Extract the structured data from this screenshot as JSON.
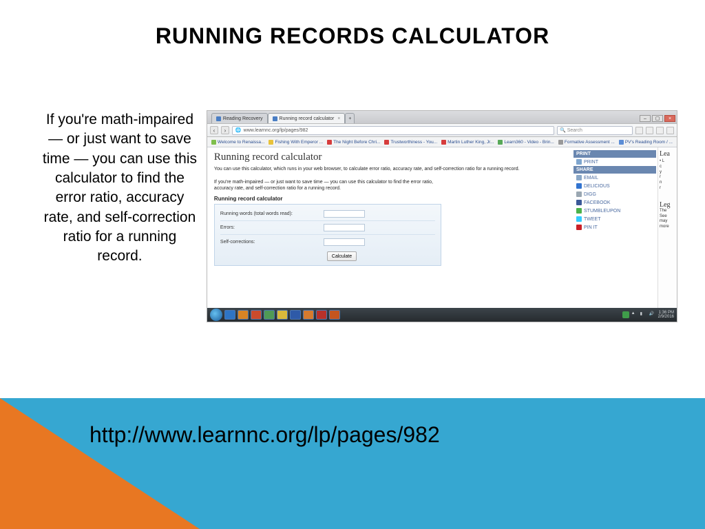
{
  "slide": {
    "title": "RUNNING RECORDS CALCULATOR",
    "blurb": "If you're math-impaired — or just want to save time — you can use this calculator to find the error ratio, accuracy rate, and self-correction ratio for a running record.",
    "url": "http://www.learnnc.org/lp/pages/982"
  },
  "browser": {
    "tabs": [
      {
        "label": "Reading Recovery",
        "active": false
      },
      {
        "label": "Running record calculator",
        "active": true
      }
    ],
    "address": "www.learnnc.org/lp/pages/982",
    "search_placeholder": "Search",
    "bookmarks": [
      {
        "label": "Welcome to Renaissa...",
        "color": "#7fbf4d"
      },
      {
        "label": "Fishing With Emperor ...",
        "color": "#e8c23a"
      },
      {
        "label": "The Night Before Chri...",
        "color": "#d63c3c"
      },
      {
        "label": "Trustworthiness - You...",
        "color": "#d63c3c"
      },
      {
        "label": "Martin Luther King, Jr...",
        "color": "#d63c3c"
      },
      {
        "label": "Learn360 - Video - Brin...",
        "color": "#58a958"
      },
      {
        "label": "Formative Assessment ...",
        "color": "#999999"
      },
      {
        "label": "PV's Reading Room / ...",
        "color": "#5b8dd6"
      }
    ],
    "page": {
      "h1": "Running record calculator",
      "intro": "You can use this calculator, which runs in your web browser, to calculate error ratio, accuracy rate, and self-correction ratio for a running record.",
      "p2": "If you're math-impaired — or just want to save time — you can use this calculator to find the error ratio, accuracy rate, and self-correction ratio for a running record.",
      "calc_heading": "Running record calculator",
      "fields": {
        "running_words": "Running words (total words read):",
        "errors": "Errors:",
        "self_corrections": "Self-corrections:"
      },
      "button": "Calculate"
    },
    "sidebar": {
      "print_head": "PRINT",
      "print_item": "PRINT",
      "share_head": "SHARE",
      "share_items": [
        {
          "label": "EMAIL",
          "color": "#8aa7c7"
        },
        {
          "label": "DELICIOUS",
          "color": "#3274d0"
        },
        {
          "label": "DIGG",
          "color": "#9aa7b2"
        },
        {
          "label": "FACEBOOK",
          "color": "#3b5998"
        },
        {
          "label": "STUMBLEUPON",
          "color": "#4bb24b"
        },
        {
          "label": "TWEET",
          "color": "#33ccff"
        },
        {
          "label": "PIN IT",
          "color": "#cb2027"
        }
      ]
    },
    "peek": {
      "h": "Lea",
      "lines": [
        "• L",
        "c",
        "y",
        "r",
        "n",
        "r"
      ],
      "leg_h": "Leg",
      "leg_lines": [
        "The",
        "See",
        "may",
        "more"
      ]
    },
    "clock": {
      "time": "1:36 PM",
      "date": "2/9/2016"
    }
  }
}
